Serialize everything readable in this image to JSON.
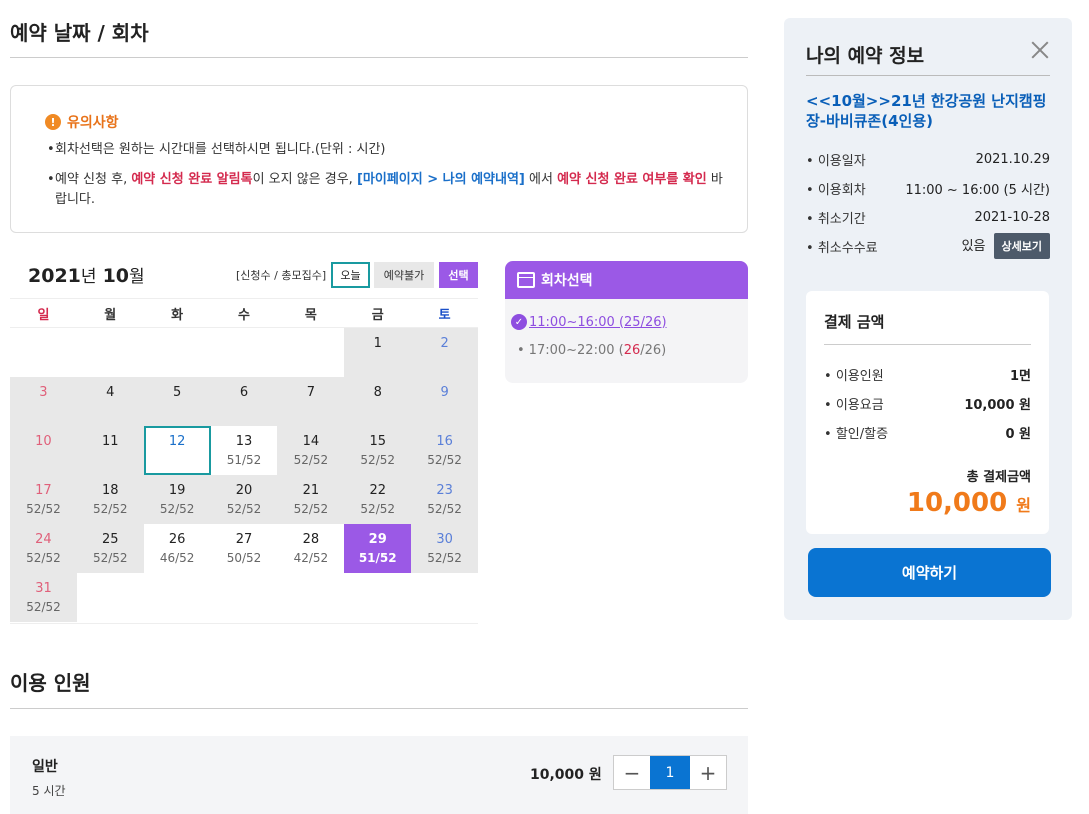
{
  "section_date": {
    "title": "예약 날짜 / 회차"
  },
  "notice": {
    "title": "유의사항",
    "line1": "회차선택은 원하는 시간대를 선택하시면 됩니다.(단위 : 시간)",
    "line2_a": "예약 신청 후, ",
    "line2_red1": "예약 신청 완료 알림톡",
    "line2_b": "이 오지 않은 경우, ",
    "line2_blue": "[마이페이지 > 나의 예약내역]",
    "line2_c": " 에서 ",
    "line2_red2": "예약 신청 완료 여부를 확인",
    "line2_d": " 바랍니다."
  },
  "calendar": {
    "year": "2021",
    "year_unit": "년",
    "month": "10",
    "month_unit": "월",
    "legend_text": "[신청수 / 총모집수]",
    "legend_today": "오늘",
    "legend_unavailable": "예약불가",
    "legend_selected": "선택",
    "weekdays": [
      "일",
      "월",
      "화",
      "수",
      "목",
      "금",
      "토"
    ],
    "weeks": [
      [
        {
          "d": "",
          "c": "",
          "s": "empty"
        },
        {
          "d": "",
          "c": "",
          "s": "empty"
        },
        {
          "d": "",
          "c": "",
          "s": "empty"
        },
        {
          "d": "",
          "c": "",
          "s": "empty"
        },
        {
          "d": "",
          "c": "",
          "s": "empty"
        },
        {
          "d": "1",
          "c": "",
          "s": "gray"
        },
        {
          "d": "2",
          "c": "",
          "s": "gray"
        }
      ],
      [
        {
          "d": "3",
          "c": "",
          "s": "gray"
        },
        {
          "d": "4",
          "c": "",
          "s": "gray"
        },
        {
          "d": "5",
          "c": "",
          "s": "gray"
        },
        {
          "d": "6",
          "c": "",
          "s": "gray"
        },
        {
          "d": "7",
          "c": "",
          "s": "gray"
        },
        {
          "d": "8",
          "c": "",
          "s": "gray"
        },
        {
          "d": "9",
          "c": "",
          "s": "gray"
        }
      ],
      [
        {
          "d": "10",
          "c": "",
          "s": "gray"
        },
        {
          "d": "11",
          "c": "",
          "s": "gray"
        },
        {
          "d": "12",
          "c": "",
          "s": "today"
        },
        {
          "d": "13",
          "c": "51/52",
          "s": "open"
        },
        {
          "d": "14",
          "c": "52/52",
          "s": "gray"
        },
        {
          "d": "15",
          "c": "52/52",
          "s": "gray"
        },
        {
          "d": "16",
          "c": "52/52",
          "s": "gray"
        }
      ],
      [
        {
          "d": "17",
          "c": "52/52",
          "s": "gray"
        },
        {
          "d": "18",
          "c": "52/52",
          "s": "gray"
        },
        {
          "d": "19",
          "c": "52/52",
          "s": "gray"
        },
        {
          "d": "20",
          "c": "52/52",
          "s": "gray"
        },
        {
          "d": "21",
          "c": "52/52",
          "s": "gray"
        },
        {
          "d": "22",
          "c": "52/52",
          "s": "gray"
        },
        {
          "d": "23",
          "c": "52/52",
          "s": "gray"
        }
      ],
      [
        {
          "d": "24",
          "c": "52/52",
          "s": "gray"
        },
        {
          "d": "25",
          "c": "52/52",
          "s": "gray"
        },
        {
          "d": "26",
          "c": "46/52",
          "s": "open"
        },
        {
          "d": "27",
          "c": "50/52",
          "s": "open"
        },
        {
          "d": "28",
          "c": "42/52",
          "s": "open"
        },
        {
          "d": "29",
          "c": "51/52",
          "s": "selected"
        },
        {
          "d": "30",
          "c": "52/52",
          "s": "gray"
        }
      ],
      [
        {
          "d": "31",
          "c": "52/52",
          "s": "gray"
        }
      ]
    ]
  },
  "session": {
    "title": "회차선택",
    "item1": "11:00~16:00 (25/26)",
    "item2_time": "17:00~22:00 (",
    "item2_used": "26",
    "item2_rest": "/26)"
  },
  "people": {
    "title": "이용 인원",
    "name": "일반",
    "duration": "5 시간",
    "price": "10,000 원",
    "minus": "−",
    "quantity": "1",
    "plus": "+"
  },
  "side": {
    "title": "나의 예약 정보",
    "program": "<<10월>>21년 한강공원 난지캠핑장-바비큐존(4인용)",
    "rows": [
      {
        "label": "이용일자",
        "value": "2021.10.29"
      },
      {
        "label": "이용회차",
        "value": "11:00 ~ 16:00 (5 시간)"
      },
      {
        "label": "취소기간",
        "value": "2021-10-28"
      },
      {
        "label": "취소수수료",
        "value": "있음"
      }
    ],
    "detail_button": "상세보기",
    "payment": {
      "title": "결제 금액",
      "rows": [
        {
          "label": "이용인원",
          "value": "1면"
        },
        {
          "label": "이용요금",
          "value": "10,000 원"
        },
        {
          "label": "할인/할증",
          "value": "0 원"
        }
      ],
      "total_label": "총 결제금액",
      "total_value": "10,000",
      "total_unit": "원"
    },
    "reserve_button": "예약하기"
  }
}
